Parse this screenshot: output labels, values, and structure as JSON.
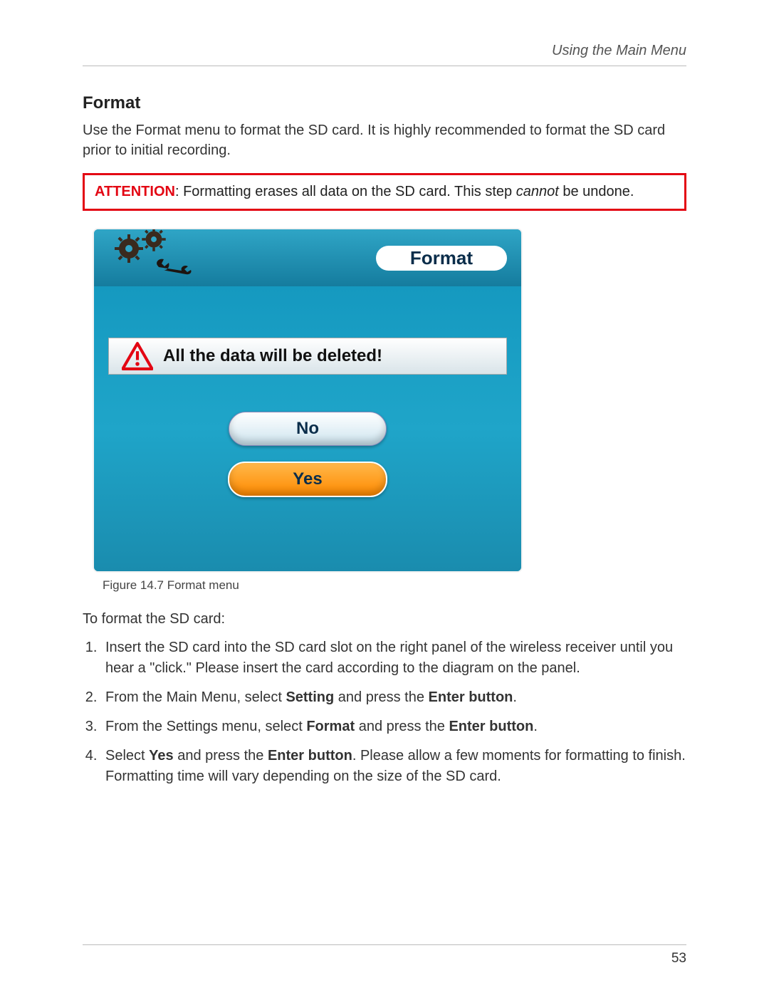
{
  "header": {
    "breadcrumb": "Using the Main Menu"
  },
  "section": {
    "title": "Format",
    "lead": "Use the Format menu to format the SD card. It is highly recommended to format the SD card prior to initial recording."
  },
  "attention": {
    "label": "ATTENTION",
    "text_before": ": Formatting erases all data on the SD card. This step ",
    "cannot_word": "cannot",
    "text_after": " be undone."
  },
  "device": {
    "format_label": "Format",
    "warn_text": "All the data will be deleted!",
    "no_label": "No",
    "yes_label": "Yes"
  },
  "figure_caption": "Figure 14.7 Format menu",
  "subhead": "To format the SD card:",
  "steps": {
    "s1": "Insert the SD card into the SD card slot on the right panel of the wireless receiver until you hear a \"click.\" Please insert the card according to the diagram on the panel.",
    "s2_a": "From the Main Menu, select ",
    "s2_b": "Setting",
    "s2_c": " and press the ",
    "s2_d": "Enter button",
    "s2_e": ".",
    "s3_a": "From the Settings menu, select ",
    "s3_b": "Format",
    "s3_c": " and press the ",
    "s3_d": "Enter button",
    "s3_e": ".",
    "s4_a": "Select ",
    "s4_b": "Yes",
    "s4_c": " and press the ",
    "s4_d": "Enter button",
    "s4_e": ". Please allow a few moments for formatting to finish. Formatting time will vary depending on the size of the SD card."
  },
  "page_number": "53"
}
